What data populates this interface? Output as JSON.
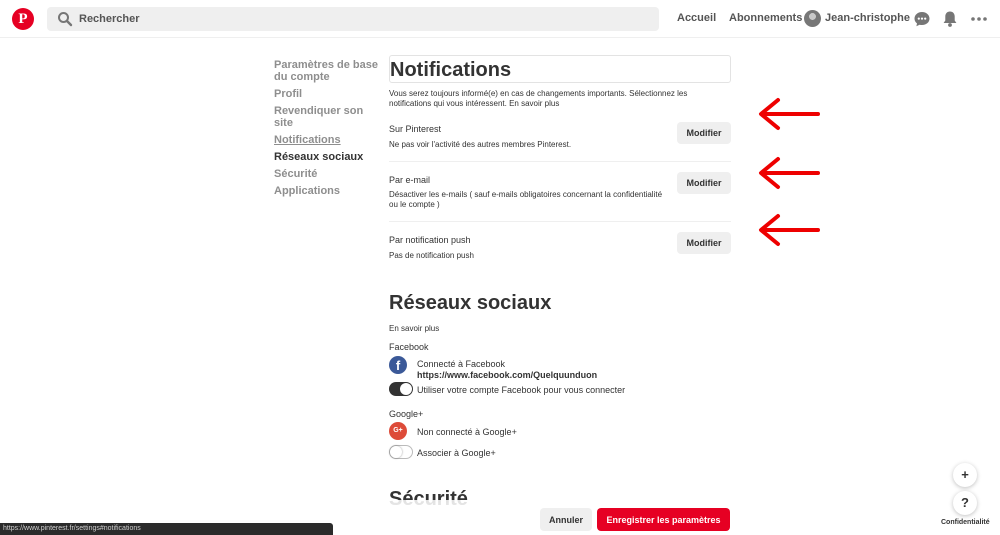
{
  "header": {
    "logo": "P",
    "search_placeholder": "Rechercher",
    "nav": {
      "home": "Accueil",
      "following": "Abonnements",
      "user": "Jean-christophe"
    }
  },
  "sidebar": {
    "items": [
      {
        "label": "Paramètres de base du compte"
      },
      {
        "label": "Profil"
      },
      {
        "label": "Revendiquer son site"
      },
      {
        "label": "Notifications"
      },
      {
        "label": "Réseaux sociaux"
      },
      {
        "label": "Sécurité"
      },
      {
        "label": "Applications"
      }
    ]
  },
  "notifications": {
    "title": "Notifications",
    "description": "Vous serez toujours informé(e) en cas de changements importants. Sélectionnez les notifications qui vous intéressent. En savoir plus",
    "settings": [
      {
        "label": "Sur Pinterest",
        "desc": "Ne pas voir l'activité des autres membres Pinterest.",
        "button": "Modifier"
      },
      {
        "label": "Par e-mail",
        "desc": "Désactiver les e-mails ( sauf e-mails obligatoires concernant la confidentialité ou le compte )",
        "button": "Modifier"
      },
      {
        "label": "Par notification push",
        "desc": "Pas de notification push",
        "button": "Modifier"
      }
    ]
  },
  "social": {
    "title": "Réseaux sociaux",
    "learn_more": "En savoir plus",
    "facebook": {
      "label": "Facebook",
      "icon": "f",
      "status": "Connecté à Facebook",
      "url": "https://www.facebook.com/Quelquunduon",
      "toggle_label": "Utiliser votre compte Facebook pour vous connecter",
      "toggle_on": true
    },
    "google": {
      "label": "Google+",
      "icon": "G+",
      "status": "Non connecté à Google+",
      "toggle_label": "Associer à Google+",
      "toggle_on": false
    }
  },
  "security": {
    "title": "Sécurité"
  },
  "footer": {
    "cancel": "Annuler",
    "save": "Enregistrer les paramètres",
    "status_url": "https://www.pinterest.fr/settings#notifications",
    "plus": "+",
    "help": "?",
    "privacy": "Confidentialité"
  },
  "colors": {
    "brand": "#e60023",
    "facebook": "#3b5998",
    "google": "#dd4b39",
    "annotation_arrow": "#ee0000"
  }
}
